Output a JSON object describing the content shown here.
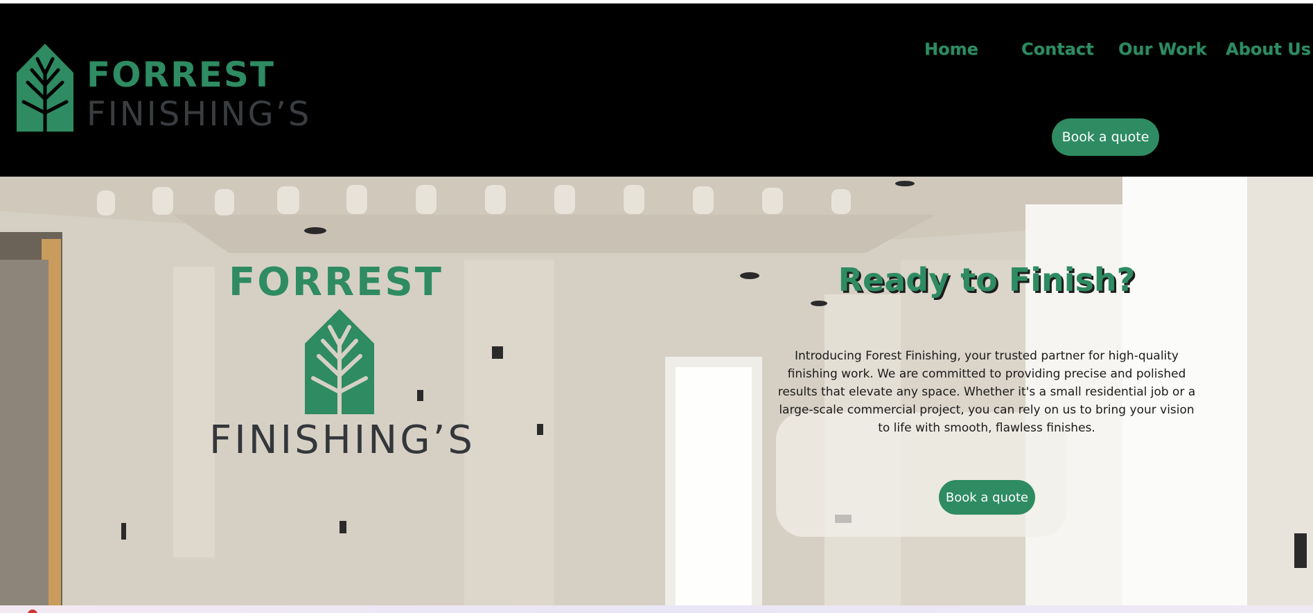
{
  "header": {
    "logo": {
      "word1": "FORREST",
      "word2": "FINISHING’S",
      "icon": "tree-house-icon"
    },
    "nav": [
      {
        "label": "Home"
      },
      {
        "label": "Contact"
      },
      {
        "label": "Our Work"
      },
      {
        "label": "About Us"
      }
    ],
    "cta_label": "Book a quote"
  },
  "hero": {
    "logo": {
      "word1": "FORREST",
      "word2": "FINISHING’S",
      "icon": "tree-house-icon"
    },
    "title": "Ready to Finish?",
    "text": "Introducing Forest Finishing, your trusted partner for high-quality finishing work. We are committed to providing precise and polished results that elevate any space. Whether it's a small residential job or a large-scale commercial project, you can rely on us to bring your vision to life with smooth, flawless finishes.",
    "cta_label": "Book a quote",
    "background": "drywall-interior-photo"
  },
  "colors": {
    "brand_green": "#2e8b62",
    "header_bg": "#000000",
    "logo_gray": "#3a3d40",
    "button_text": "#ffffff"
  }
}
